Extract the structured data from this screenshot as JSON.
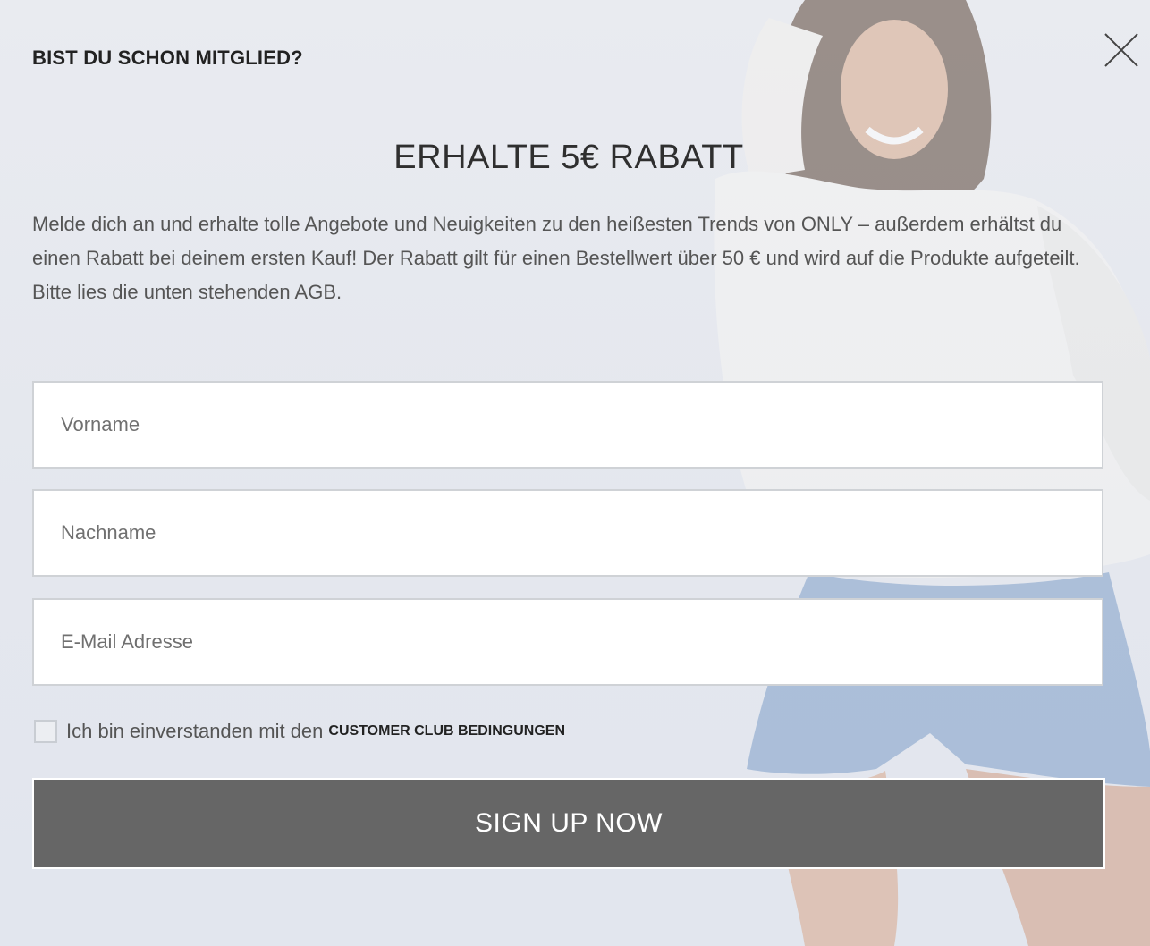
{
  "header": {
    "member_label": "BIST DU SCHON MITGLIED?",
    "close_icon": "close-icon"
  },
  "promo": {
    "title": "ERHALTE 5€ RABATT",
    "description": "Melde dich an und erhalte tolle Angebote und Neuigkeiten zu den heißesten Trends von ONLY – außerdem erhältst du einen Rabatt bei deinem ersten Kauf! Der Rabatt gilt für einen Bestellwert über 50 € und wird auf die Produkte aufgeteilt. Bitte lies die unten stehenden AGB."
  },
  "form": {
    "first_name": {
      "value": "",
      "placeholder": "Vorname"
    },
    "last_name": {
      "value": "",
      "placeholder": "Nachname"
    },
    "email": {
      "value": "",
      "placeholder": "E-Mail Adresse"
    },
    "consent": {
      "checked": false,
      "text": "Ich bin einverstanden mit den",
      "link_label": "CUSTOMER CLUB BEDINGUNGEN"
    },
    "submit_label": "SIGN UP NOW"
  },
  "colors": {
    "background": "#e6e9ef",
    "button_bg": "#666666",
    "button_text": "#ffffff",
    "field_border": "#cfd2d6",
    "heading_text": "#222222"
  }
}
